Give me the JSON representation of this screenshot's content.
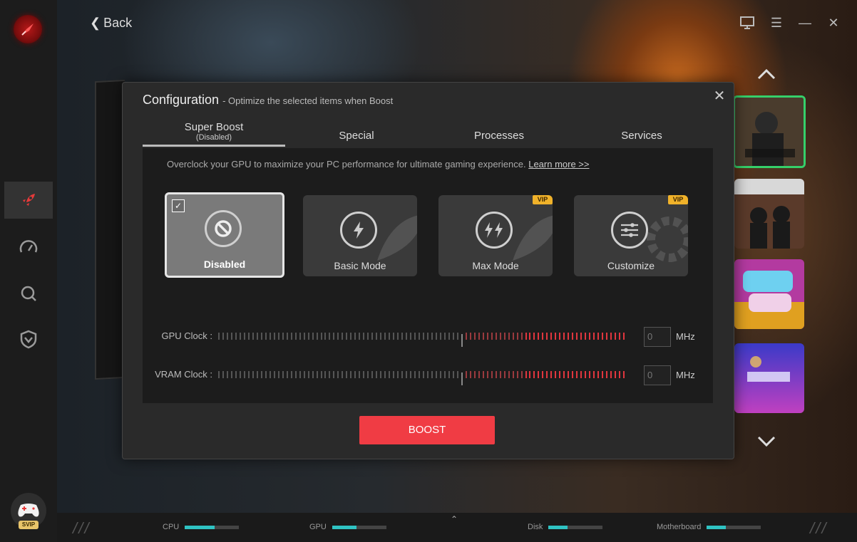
{
  "header": {
    "back_label": "Back"
  },
  "modal": {
    "title": "Configuration",
    "subtitle": "- Optimize the selected items when Boost",
    "tabs": [
      {
        "label": "Super Boost",
        "sub": "(Disabled)"
      },
      {
        "label": "Special"
      },
      {
        "label": "Processes"
      },
      {
        "label": "Services"
      }
    ],
    "description": "Overclock your GPU to maximize your PC performance for ultimate gaming experience.",
    "learn_more": "Learn more >>",
    "modes": [
      {
        "label": "Disabled",
        "icon": "ban-icon",
        "selected": true,
        "vip": false
      },
      {
        "label": "Basic Mode",
        "icon": "lightning-icon",
        "selected": false,
        "vip": false
      },
      {
        "label": "Max Mode",
        "icon": "double-lightning-icon",
        "selected": false,
        "vip": true
      },
      {
        "label": "Customize",
        "icon": "sliders-icon",
        "selected": false,
        "vip": true
      }
    ],
    "vip_label": "VIP",
    "sliders": [
      {
        "label": "GPU Clock :",
        "value": "0",
        "unit": "MHz"
      },
      {
        "label": "VRAM Clock :",
        "value": "0",
        "unit": "MHz"
      }
    ],
    "boost_label": "BOOST"
  },
  "sidebar": {
    "svip_label": "SVIP"
  },
  "statusbar": {
    "items": [
      {
        "label": "CPU",
        "level": 0.55
      },
      {
        "label": "GPU",
        "level": 0.45
      },
      {
        "label": "Disk",
        "level": 0.35
      },
      {
        "label": "Motherboard",
        "level": 0.35
      }
    ]
  },
  "colors": {
    "accent": "#f03c44",
    "selected_game": "#35d06a",
    "vip": "#f0b22a",
    "meter": "#2fc3c3"
  }
}
